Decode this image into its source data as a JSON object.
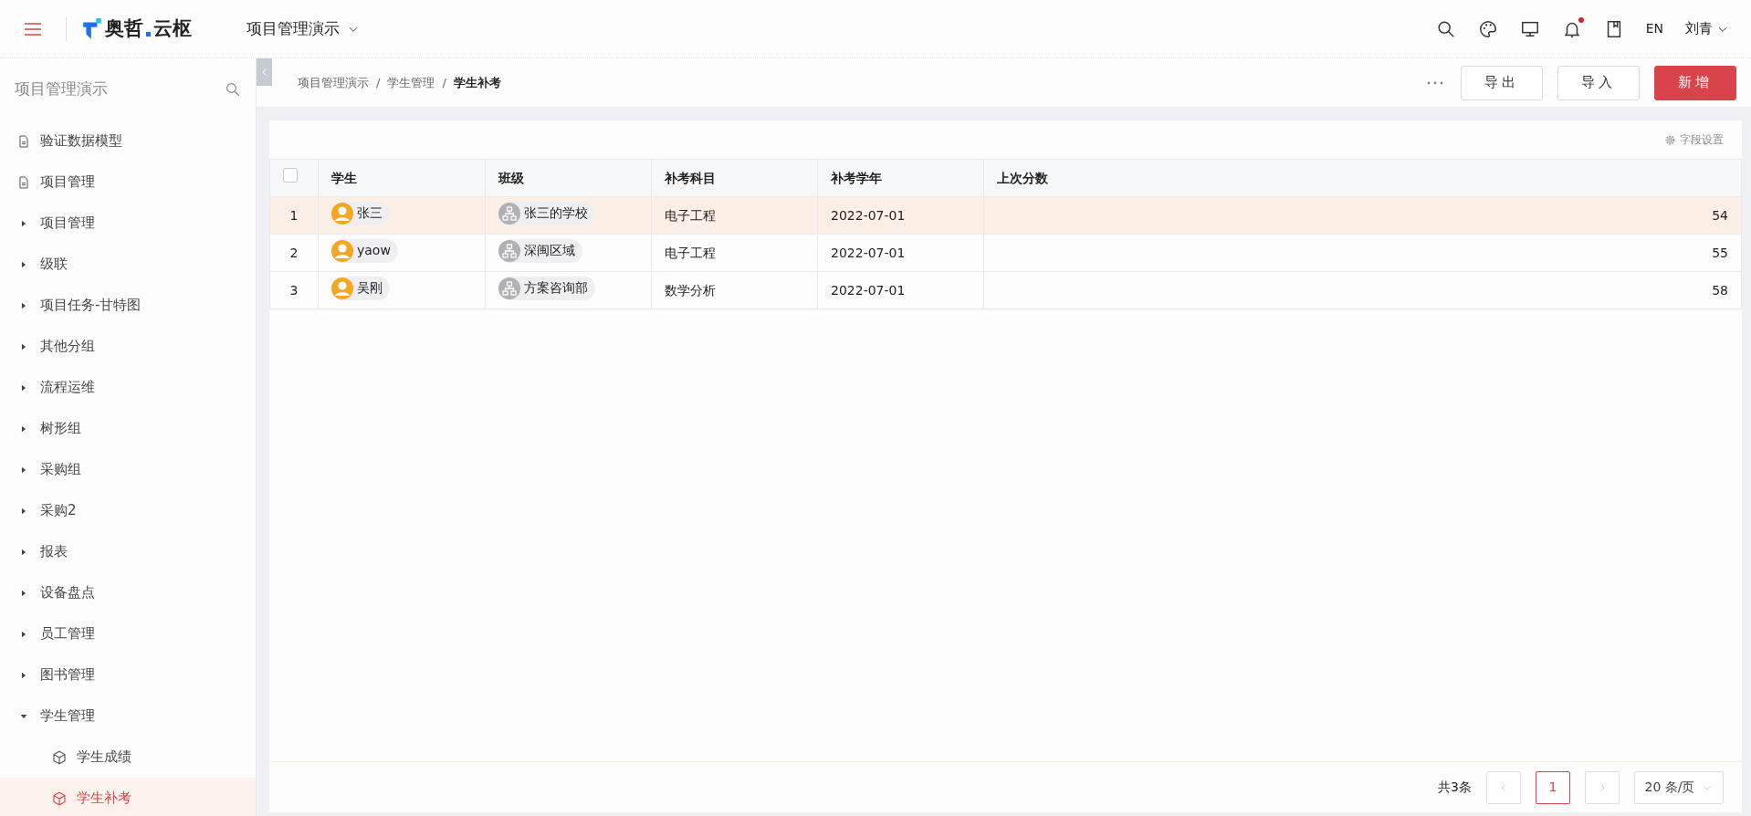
{
  "topbar": {
    "logo_left": "奥哲",
    "logo_right": "云枢",
    "app": "项目管理演示",
    "icons": [
      {
        "kind": "search"
      },
      {
        "kind": "palette"
      },
      {
        "kind": "monitor"
      },
      {
        "kind": "bell",
        "unread": true
      },
      {
        "kind": "book"
      }
    ],
    "language": "EN",
    "user": "刘青"
  },
  "sidebar": {
    "title": "项目管理演示",
    "items": [
      {
        "kind": "page",
        "label": "验证数据模型"
      },
      {
        "kind": "page",
        "label": "项目管理"
      },
      {
        "kind": "group",
        "label": "项目管理",
        "expanded": false
      },
      {
        "kind": "group",
        "label": "级联",
        "expanded": false
      },
      {
        "kind": "group",
        "label": "项目任务-甘特图",
        "expanded": false
      },
      {
        "kind": "group",
        "label": "其他分组",
        "expanded": false
      },
      {
        "kind": "group",
        "label": "流程运维",
        "expanded": false
      },
      {
        "kind": "group",
        "label": "树形组",
        "expanded": false
      },
      {
        "kind": "group",
        "label": "采购组",
        "expanded": false
      },
      {
        "kind": "group",
        "label": "采购2",
        "expanded": false
      },
      {
        "kind": "group",
        "label": "报表",
        "expanded": false
      },
      {
        "kind": "group",
        "label": "设备盘点",
        "expanded": false
      },
      {
        "kind": "group",
        "label": "员工管理",
        "expanded": false
      },
      {
        "kind": "group",
        "label": "图书管理",
        "expanded": false
      },
      {
        "kind": "group",
        "label": "学生管理",
        "expanded": true,
        "children": [
          {
            "kind": "module",
            "label": "学生成绩",
            "selected": false
          },
          {
            "kind": "module",
            "label": "学生补考",
            "selected": true
          }
        ]
      }
    ]
  },
  "breadcrumb": [
    {
      "label": "项目管理演示"
    },
    {
      "separator": "/",
      "label": "学生管理"
    },
    {
      "separator": "/",
      "label": "学生补考"
    }
  ],
  "actions": [
    {
      "kind": "outline",
      "label": "导出"
    },
    {
      "kind": "outline",
      "label": "导入"
    },
    {
      "kind": "primary",
      "label": "新增"
    }
  ],
  "field_settings": "字段设置",
  "table": {
    "select_all_checked": false,
    "columns": [
      "学生",
      "班级",
      "补考科目",
      "补考学年",
      "上次分数"
    ],
    "rows": [
      {
        "index": "1",
        "student": "张三",
        "class": "张三的学校",
        "subject": "电子工程",
        "year": "2022-07-01",
        "score": "54",
        "hovered": true
      },
      {
        "index": "2",
        "student": "yaow",
        "class": "深闽区域",
        "subject": "电子工程",
        "year": "2022-07-01",
        "score": "55",
        "hovered": false
      },
      {
        "index": "3",
        "student": "吴刚",
        "class": "方案咨询部",
        "subject": "数学分析",
        "year": "2022-07-01",
        "score": "58",
        "hovered": false
      }
    ]
  },
  "pagination": {
    "total": "共3条",
    "pages": [
      {
        "label": "1",
        "selected": true
      }
    ],
    "page_size": "20 条/页"
  }
}
